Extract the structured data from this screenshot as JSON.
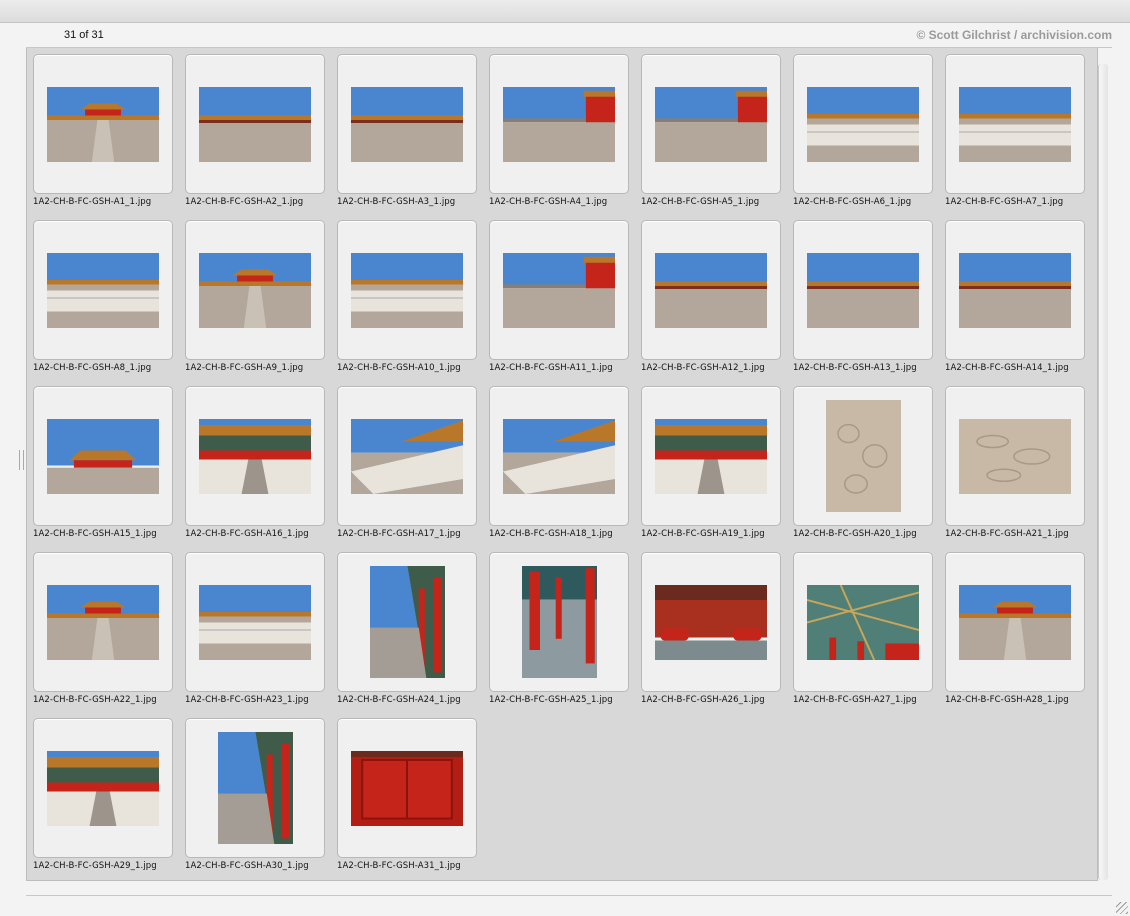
{
  "header": {
    "counter": "31 of 31",
    "credit": "© Scott Gilchrist / archivision.com"
  },
  "thumbnails": [
    {
      "file": "1A2-CH-B-FC-GSH-A1_1.jpg",
      "orientation": "landscape",
      "scene": "courtyard"
    },
    {
      "file": "1A2-CH-B-FC-GSH-A2_1.jpg",
      "orientation": "landscape",
      "scene": "open-plaza"
    },
    {
      "file": "1A2-CH-B-FC-GSH-A3_1.jpg",
      "orientation": "landscape",
      "scene": "open-plaza"
    },
    {
      "file": "1A2-CH-B-FC-GSH-A4_1.jpg",
      "orientation": "landscape",
      "scene": "plaza-red-wall"
    },
    {
      "file": "1A2-CH-B-FC-GSH-A5_1.jpg",
      "orientation": "landscape",
      "scene": "plaza-red-wall"
    },
    {
      "file": "1A2-CH-B-FC-GSH-A6_1.jpg",
      "orientation": "landscape",
      "scene": "balustrade"
    },
    {
      "file": "1A2-CH-B-FC-GSH-A7_1.jpg",
      "orientation": "landscape",
      "scene": "balustrade"
    },
    {
      "file": "1A2-CH-B-FC-GSH-A8_1.jpg",
      "orientation": "landscape",
      "scene": "balustrade"
    },
    {
      "file": "1A2-CH-B-FC-GSH-A9_1.jpg",
      "orientation": "landscape",
      "scene": "courtyard"
    },
    {
      "file": "1A2-CH-B-FC-GSH-A10_1.jpg",
      "orientation": "landscape",
      "scene": "balustrade"
    },
    {
      "file": "1A2-CH-B-FC-GSH-A11_1.jpg",
      "orientation": "landscape",
      "scene": "plaza-red-wall"
    },
    {
      "file": "1A2-CH-B-FC-GSH-A12_1.jpg",
      "orientation": "landscape",
      "scene": "open-plaza"
    },
    {
      "file": "1A2-CH-B-FC-GSH-A13_1.jpg",
      "orientation": "landscape",
      "scene": "open-plaza"
    },
    {
      "file": "1A2-CH-B-FC-GSH-A14_1.jpg",
      "orientation": "landscape",
      "scene": "open-plaza"
    },
    {
      "file": "1A2-CH-B-FC-GSH-A15_1.jpg",
      "orientation": "landscape",
      "scene": "hall-far"
    },
    {
      "file": "1A2-CH-B-FC-GSH-A16_1.jpg",
      "orientation": "landscape",
      "scene": "hall-near"
    },
    {
      "file": "1A2-CH-B-FC-GSH-A17_1.jpg",
      "orientation": "landscape",
      "scene": "stairs"
    },
    {
      "file": "1A2-CH-B-FC-GSH-A18_1.jpg",
      "orientation": "landscape",
      "scene": "stairs"
    },
    {
      "file": "1A2-CH-B-FC-GSH-A19_1.jpg",
      "orientation": "landscape",
      "scene": "hall-near"
    },
    {
      "file": "1A2-CH-B-FC-GSH-A20_1.jpg",
      "orientation": "portrait",
      "scene": "carving"
    },
    {
      "file": "1A2-CH-B-FC-GSH-A21_1.jpg",
      "orientation": "landscape",
      "scene": "carving"
    },
    {
      "file": "1A2-CH-B-FC-GSH-A22_1.jpg",
      "orientation": "landscape",
      "scene": "courtyard"
    },
    {
      "file": "1A2-CH-B-FC-GSH-A23_1.jpg",
      "orientation": "landscape",
      "scene": "balustrade"
    },
    {
      "file": "1A2-CH-B-FC-GSH-A24_1.jpg",
      "orientation": "portrait",
      "scene": "corridor"
    },
    {
      "file": "1A2-CH-B-FC-GSH-A25_1.jpg",
      "orientation": "portrait",
      "scene": "columns"
    },
    {
      "file": "1A2-CH-B-FC-GSH-A26_1.jpg",
      "orientation": "landscape",
      "scene": "interior"
    },
    {
      "file": "1A2-CH-B-FC-GSH-A27_1.jpg",
      "orientation": "landscape",
      "scene": "ceiling"
    },
    {
      "file": "1A2-CH-B-FC-GSH-A28_1.jpg",
      "orientation": "landscape",
      "scene": "courtyard"
    },
    {
      "file": "1A2-CH-B-FC-GSH-A29_1.jpg",
      "orientation": "landscape",
      "scene": "hall-near"
    },
    {
      "file": "1A2-CH-B-FC-GSH-A30_1.jpg",
      "orientation": "portrait",
      "scene": "corridor"
    },
    {
      "file": "1A2-CH-B-FC-GSH-A31_1.jpg",
      "orientation": "landscape",
      "scene": "red-doors"
    }
  ],
  "colors": {
    "sky": "#4a86d0",
    "pavement": "#b3a79b",
    "roof": "#b9772a",
    "red": "#c4241a",
    "marble": "#e8e4dc"
  }
}
